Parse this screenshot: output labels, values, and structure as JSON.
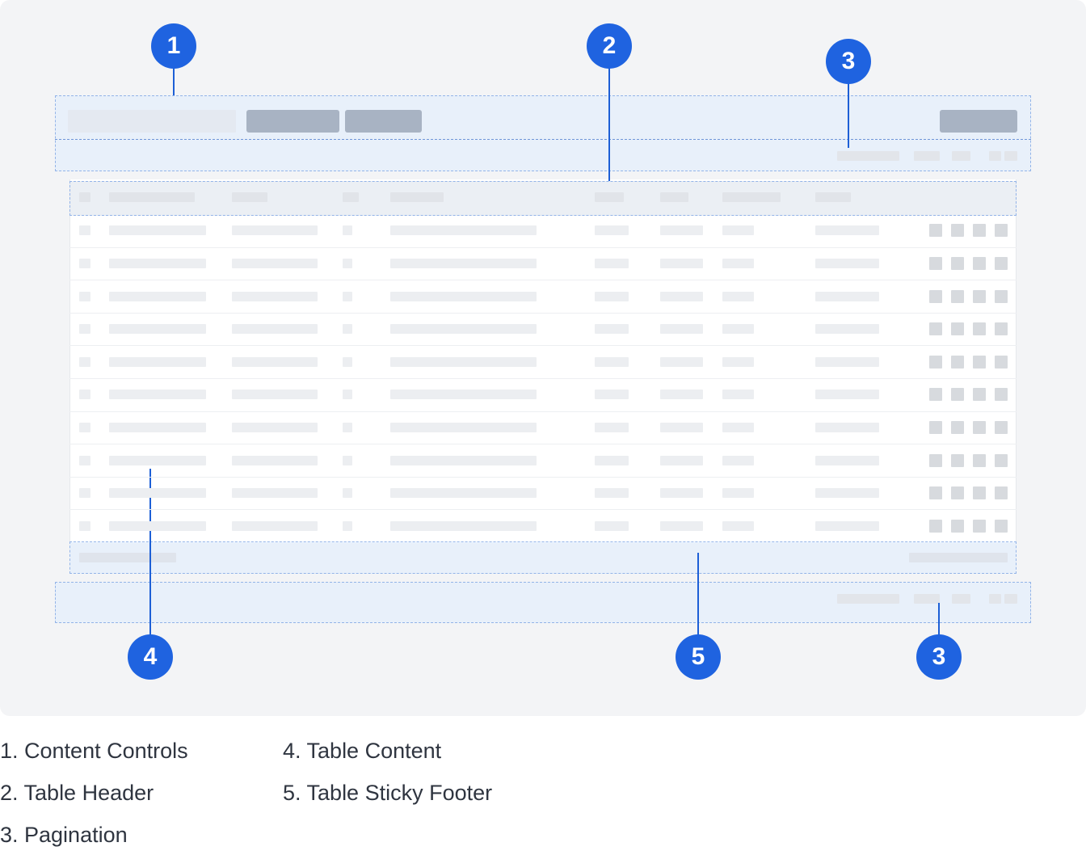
{
  "callouts": {
    "c1": "1",
    "c2": "2",
    "c3_top": "3",
    "c3_bottom": "3",
    "c4": "4",
    "c5": "5"
  },
  "legend": [
    "1. Content Controls",
    "2. Table Header",
    "3. Pagination",
    "4. Table Content",
    "5. Table Sticky Footer"
  ],
  "table": {
    "row_count": 10,
    "action_icons_per_row": 4
  },
  "colors": {
    "badge": "#1f63e0",
    "leader": "#1d5fd6",
    "region_border": "#93b4e8",
    "button_placeholder": "#a8b3c3"
  }
}
